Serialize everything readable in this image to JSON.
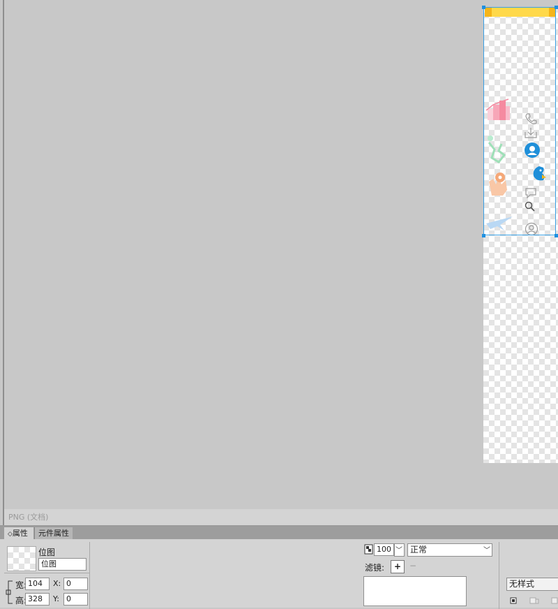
{
  "canvas": {
    "background": "#c8c8c8"
  },
  "document": {
    "status_text": "PNG (文档)",
    "selection_color": "#39a0e5",
    "header_bar_color": "#ffd94a"
  },
  "sprites": [
    {
      "name": "pink-building-icon",
      "color": "#f58aa0"
    },
    {
      "name": "green-figure-icon",
      "color": "#9fe0b8"
    },
    {
      "name": "orange-hand-location-icon",
      "color": "#f5a878"
    },
    {
      "name": "airplane-icon",
      "color": "#9cc6ee"
    },
    {
      "name": "phone-icon",
      "color": "#9a9a9a"
    },
    {
      "name": "download-icon",
      "color": "#9a9a9a"
    },
    {
      "name": "user-circle-blue-icon",
      "color": "#1f8fd9"
    },
    {
      "name": "bird-mascot-icon",
      "color": "#1f8fd9"
    },
    {
      "name": "chat-icon",
      "color": "#9a9a9a"
    },
    {
      "name": "search-icon",
      "color": "#555555"
    },
    {
      "name": "user-circle-gray-icon",
      "color": "#9a9a9a"
    }
  ],
  "properties_panel": {
    "tabs": [
      "属性",
      "元件属性"
    ],
    "active_tab": "属性",
    "object_type_label": "位图",
    "object_name_value": "位图",
    "width_label": "宽:",
    "width_value": "104",
    "height_label": "高:",
    "height_value": "328",
    "x_label": "X:",
    "x_value": "0",
    "y_label": "Y:",
    "y_value": "0",
    "opacity_value": "100",
    "blend_mode": "正常",
    "filters_label": "滤镜:",
    "add_filter_symbol": "+",
    "remove_filter_symbol": "−",
    "style_value": "无样式"
  }
}
